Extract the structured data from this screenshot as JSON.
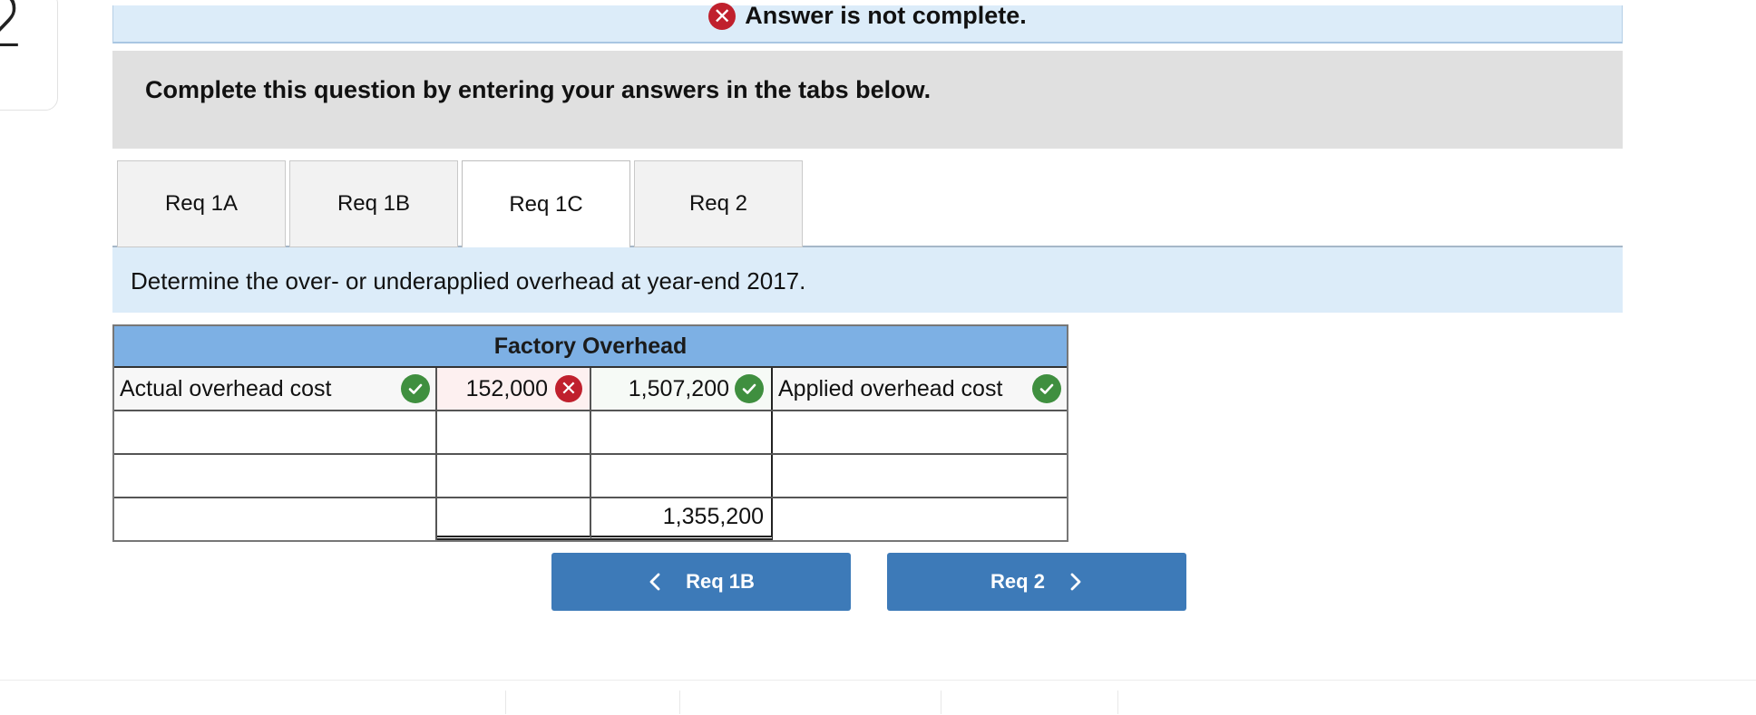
{
  "question_number": "2",
  "banner": {
    "text": "Answer is not complete.",
    "icon": "error-x-icon",
    "color": "#c0202d"
  },
  "instructions": "Complete this question by entering your answers in the tabs below.",
  "tabs": [
    {
      "label": "Req 1A",
      "active": false
    },
    {
      "label": "Req 1B",
      "active": false
    },
    {
      "label": "Req 1C",
      "active": true
    },
    {
      "label": "Req 2",
      "active": false
    }
  ],
  "prompt": "Determine the over- or underapplied overhead at year-end 2017.",
  "t_account": {
    "title": "Factory Overhead",
    "header_color": "#7db0e4",
    "rows": [
      {
        "left_label": "Actual overhead cost",
        "left_label_status": "correct",
        "left_amount": "152,000",
        "left_amount_status": "incorrect",
        "right_amount": "1,507,200",
        "right_amount_status": "correct",
        "right_label": "Applied overhead cost",
        "right_label_status": "correct"
      },
      {
        "left_label": "",
        "left_amount": "",
        "right_amount": "",
        "right_label": ""
      },
      {
        "left_label": "",
        "left_amount": "",
        "right_amount": "",
        "right_label": ""
      },
      {
        "left_label": "",
        "left_amount": "",
        "right_amount": "1,355,200",
        "right_label": ""
      }
    ]
  },
  "nav": {
    "prev_label": "Req 1B",
    "next_label": "Req 2",
    "button_color": "#3d7ab8"
  }
}
